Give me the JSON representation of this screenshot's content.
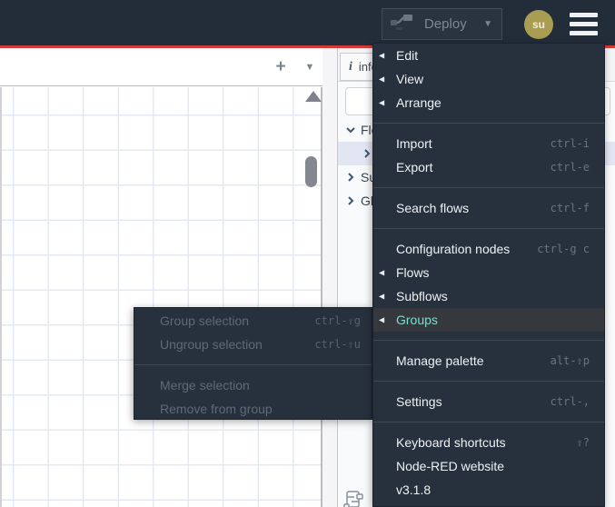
{
  "colors": {
    "accent_red": "#d53a3a",
    "header_bg": "#232d3a",
    "menu_bg": "#27313e",
    "menu_highlight_bg": "#35393d",
    "menu_highlight_text": "#7edbce",
    "avatar_bg": "#a89d52",
    "selected_row_bg": "#e2e5f2",
    "grid_line": "#e5e9f5"
  },
  "header": {
    "deploy_label": "Deploy",
    "deploy_chevron": "▼",
    "avatar_initials": "su"
  },
  "workspace": {
    "add_flow_label": "+",
    "flow_list_label": "▼"
  },
  "sidebar": {
    "info_tab_icon": "i",
    "info_tab_label": "info",
    "search_value": "",
    "tree": [
      {
        "label": "Flo",
        "chevron": "down",
        "selected": false
      },
      {
        "label": "",
        "chevron": "right",
        "selected": true
      },
      {
        "label": "Su",
        "chevron": "right",
        "selected": false
      },
      {
        "label": "Glo",
        "chevron": "right",
        "selected": false
      }
    ]
  },
  "menu": {
    "arrow_glyph": "◀",
    "sections": [
      {
        "items": [
          {
            "label": "Edit",
            "shortcut": "",
            "arrow": true
          },
          {
            "label": "View",
            "shortcut": "",
            "arrow": true
          },
          {
            "label": "Arrange",
            "shortcut": "",
            "arrow": true
          }
        ]
      },
      {
        "items": [
          {
            "label": "Import",
            "shortcut": "ctrl-i",
            "arrow": false
          },
          {
            "label": "Export",
            "shortcut": "ctrl-e",
            "arrow": false
          }
        ]
      },
      {
        "items": [
          {
            "label": "Search flows",
            "shortcut": "ctrl-f",
            "arrow": false
          }
        ]
      },
      {
        "items": [
          {
            "label": "Configuration nodes",
            "shortcut": "ctrl-g c",
            "arrow": false
          },
          {
            "label": "Flows",
            "shortcut": "",
            "arrow": true
          },
          {
            "label": "Subflows",
            "shortcut": "",
            "arrow": true
          },
          {
            "label": "Groups",
            "shortcut": "",
            "arrow": true,
            "highlighted": true
          }
        ]
      },
      {
        "items": [
          {
            "label": "Manage palette",
            "shortcut": "alt-⇧p",
            "arrow": false
          }
        ]
      },
      {
        "items": [
          {
            "label": "Settings",
            "shortcut": "ctrl-,",
            "arrow": false
          }
        ]
      },
      {
        "items": [
          {
            "label": "Keyboard shortcuts",
            "shortcut": "⇧?",
            "arrow": false
          },
          {
            "label": "Node-RED website",
            "shortcut": "",
            "arrow": false
          },
          {
            "label": "v3.1.8",
            "shortcut": "",
            "arrow": false
          }
        ]
      }
    ]
  },
  "submenu": {
    "items": [
      {
        "label": "Group selection",
        "shortcut": "ctrl-⇧g",
        "disabled": true
      },
      {
        "label": "Ungroup selection",
        "shortcut": "ctrl-⇧u",
        "disabled": true
      },
      {
        "label": "Merge selection",
        "shortcut": "",
        "disabled": true
      },
      {
        "label": "Remove from group",
        "shortcut": "",
        "disabled": true
      }
    ]
  }
}
